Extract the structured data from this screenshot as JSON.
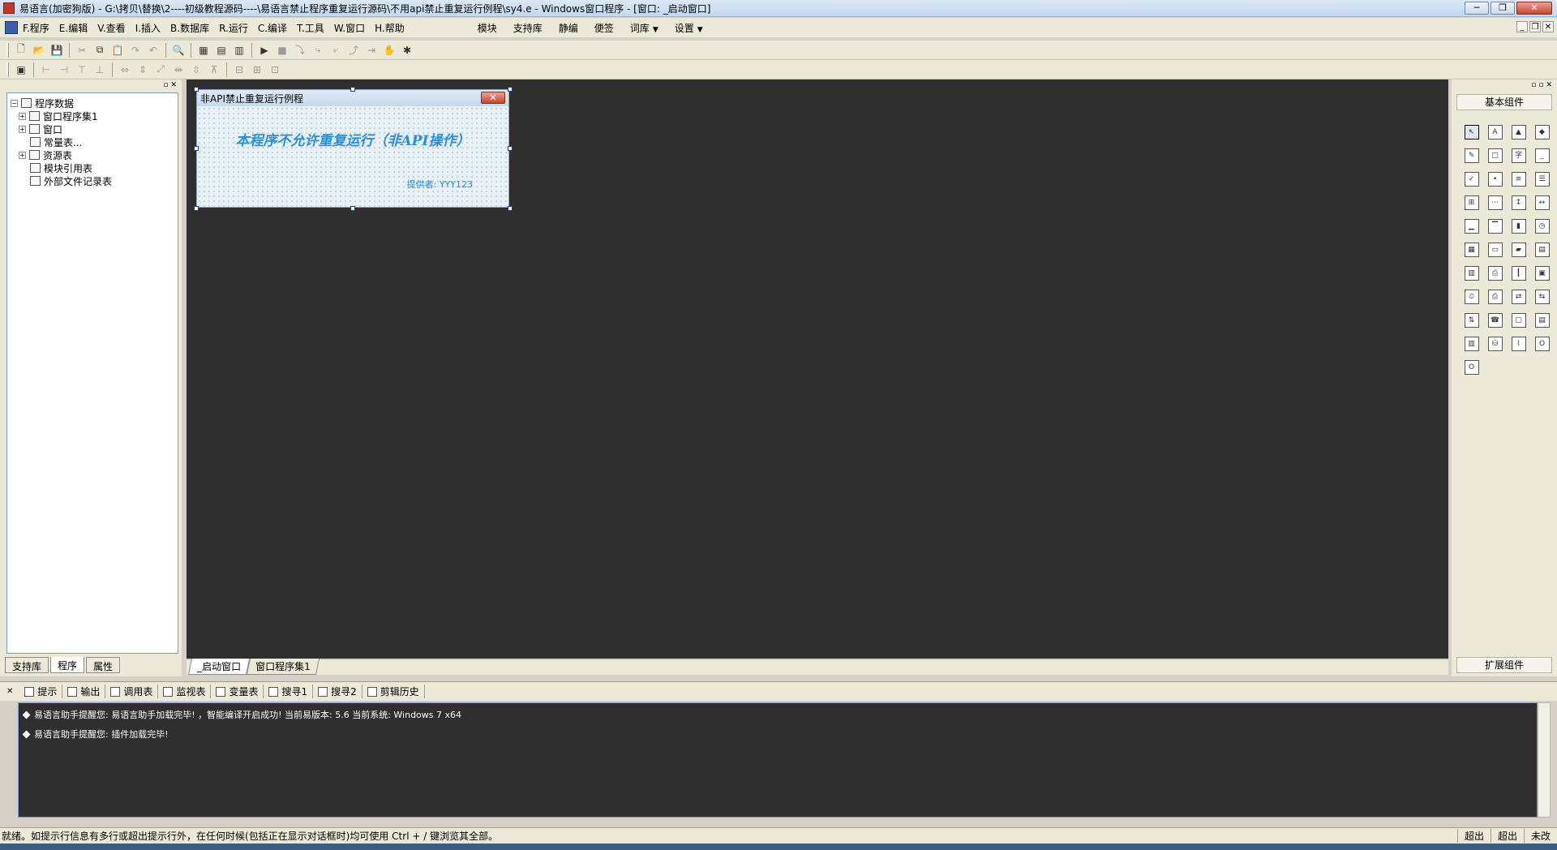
{
  "window": {
    "title": "易语言(加密狗版) - G:\\拷贝\\替换\\2----初级教程源码----\\易语言禁止程序重复运行源码\\不用api禁止重复运行例程\\sy4.e - Windows窗口程序 - [窗口: _启动窗口]"
  },
  "menu": {
    "items": [
      "F.程序",
      "E.编辑",
      "V.查看",
      "I.插入",
      "B.数据库",
      "R.运行",
      "C.编译",
      "T.工具",
      "W.窗口",
      "H.帮助"
    ],
    "extra": [
      "模块",
      "支持库",
      "静编",
      "便签",
      "词库",
      "设置"
    ]
  },
  "left_panel": {
    "tree": {
      "root": "程序数据",
      "items": [
        "窗口程序集1",
        "窗口",
        "常量表...",
        "资源表",
        "模块引用表",
        "外部文件记录表"
      ]
    },
    "tabs": [
      "支持库",
      "程序",
      "属性"
    ]
  },
  "form": {
    "title": "非API禁止重复运行例程",
    "label_main": "本程序不允许重复运行（非API操作）",
    "label_author": "提供者: YYY123"
  },
  "editor_tabs": [
    "_启动窗口",
    "窗口程序集1"
  ],
  "right_panel": {
    "group_top": "基本组件",
    "group_bottom": "扩展组件",
    "components": [
      {
        "icon": "pointer",
        "glyph": "↖"
      },
      {
        "icon": "label",
        "glyph": "A"
      },
      {
        "icon": "picture",
        "glyph": "▲"
      },
      {
        "icon": "shape",
        "glyph": "◆"
      },
      {
        "icon": "edit",
        "glyph": "✎"
      },
      {
        "icon": "frame",
        "glyph": "□"
      },
      {
        "icon": "char",
        "glyph": "字"
      },
      {
        "icon": "line",
        "glyph": "_"
      },
      {
        "icon": "checkbox",
        "glyph": "✓"
      },
      {
        "icon": "radio",
        "glyph": "•"
      },
      {
        "icon": "listbox",
        "glyph": "≡"
      },
      {
        "icon": "combobox",
        "glyph": "☰"
      },
      {
        "icon": "grid",
        "glyph": "⊞"
      },
      {
        "icon": "scale",
        "glyph": "⋯"
      },
      {
        "icon": "vscroll",
        "glyph": "↕"
      },
      {
        "icon": "hscroll",
        "glyph": "↔"
      },
      {
        "icon": "ruler",
        "glyph": "▁"
      },
      {
        "icon": "tab",
        "glyph": "▔"
      },
      {
        "icon": "progress",
        "glyph": "▮"
      },
      {
        "icon": "clock",
        "glyph": "◷"
      },
      {
        "icon": "calendar",
        "glyph": "▦"
      },
      {
        "icon": "statusbar",
        "glyph": "▭"
      },
      {
        "icon": "folder",
        "glyph": "▰"
      },
      {
        "icon": "document",
        "glyph": "▤"
      },
      {
        "icon": "table",
        "glyph": "▥"
      },
      {
        "icon": "printer",
        "glyph": "⎙"
      },
      {
        "icon": "splitter",
        "glyph": "┃"
      },
      {
        "icon": "panel",
        "glyph": "▣"
      },
      {
        "icon": "timer",
        "glyph": "⏲"
      },
      {
        "icon": "print",
        "glyph": "⎙"
      },
      {
        "icon": "network",
        "glyph": "⇄"
      },
      {
        "icon": "network2",
        "glyph": "⇆"
      },
      {
        "icon": "socket",
        "glyph": "⇅"
      },
      {
        "icon": "dialup",
        "glyph": "☎"
      },
      {
        "icon": "window",
        "glyph": "▢"
      },
      {
        "icon": "windows",
        "glyph": "▤"
      },
      {
        "icon": "dbtable",
        "glyph": "▥"
      },
      {
        "icon": "database",
        "glyph": "⛁"
      },
      {
        "icon": "chart",
        "glyph": "⌇"
      },
      {
        "icon": "odbc",
        "glyph": "O"
      },
      {
        "icon": "odbc2",
        "glyph": "O"
      }
    ]
  },
  "output_tabs": [
    "提示",
    "输出",
    "调用表",
    "监视表",
    "变量表",
    "搜寻1",
    "搜寻2",
    "剪辑历史"
  ],
  "output_lines": [
    "易语言助手提醒您: 易语言助手加载完毕! ，智能编译开启成功! 当前易版本: 5.6 当前系统: Windows 7 x64",
    "易语言助手提醒您: 插件加载完毕!"
  ],
  "status": {
    "text": "就绪。如提示行信息有多行或超出提示行外，在任何时候(包括正在显示对话框时)均可使用 Ctrl + / 键浏览其全部。",
    "pane1": "超出",
    "pane2": "超出",
    "pane3": "未改"
  }
}
